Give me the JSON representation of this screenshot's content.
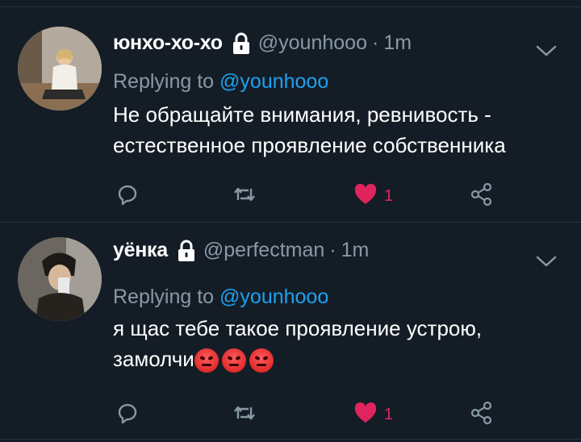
{
  "tweets": [
    {
      "name": "юнхо-хо-хо",
      "handle": "@younhooo",
      "dot": "·",
      "time": "1m",
      "replying_prefix": "Replying to ",
      "replying_to": "@younhooo",
      "text": "Не обращайте внимания, ревнивость - естественное проявление собственника",
      "emojis": [],
      "like_count": "1",
      "icons": [
        "lock-icon",
        "chevron-down-icon",
        "reply-icon",
        "retweet-icon",
        "heart-icon",
        "share-icon"
      ]
    },
    {
      "name": "уёнка",
      "handle": "@perfectman",
      "dot": "·",
      "time": "1m",
      "replying_prefix": "Replying to ",
      "replying_to": "@younhooo",
      "text_line1": "я щас тебе такое проявление устрою,",
      "text_line2": "замолчи",
      "emojis": [
        "angry-face",
        "angry-face",
        "angry-face"
      ],
      "like_count": "1",
      "icons": [
        "lock-icon",
        "chevron-down-icon",
        "reply-icon",
        "retweet-icon",
        "heart-icon",
        "share-icon"
      ]
    }
  ],
  "colors": {
    "background": "#141d26",
    "secondary_text": "#8899a6",
    "link": "#1da1f2",
    "like": "#e0245e",
    "divider": "#2a3542"
  }
}
